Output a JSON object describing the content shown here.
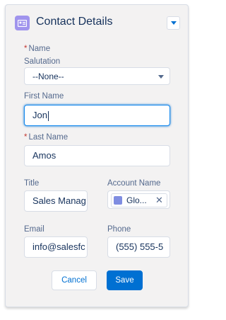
{
  "header": {
    "title": "Contact Details"
  },
  "fields": {
    "name_section_label": "Name",
    "salutation_label": "Salutation",
    "salutation_value": "--None--",
    "first_name_label": "First Name",
    "first_name_value": "Jon",
    "last_name_label": "Last Name",
    "last_name_value": "Amos",
    "title_label": "Title",
    "title_value": "Sales Manag",
    "account_name_label": "Account Name",
    "account_name_value": "Glo...",
    "email_label": "Email",
    "email_value": "info@salesfc",
    "phone_label": "Phone",
    "phone_value": "(555) 555-5"
  },
  "required_marker": "*",
  "buttons": {
    "cancel": "Cancel",
    "save": "Save"
  },
  "colors": {
    "accent": "#0070d2",
    "header_icon": "#a094ed",
    "required": "#c23934"
  }
}
